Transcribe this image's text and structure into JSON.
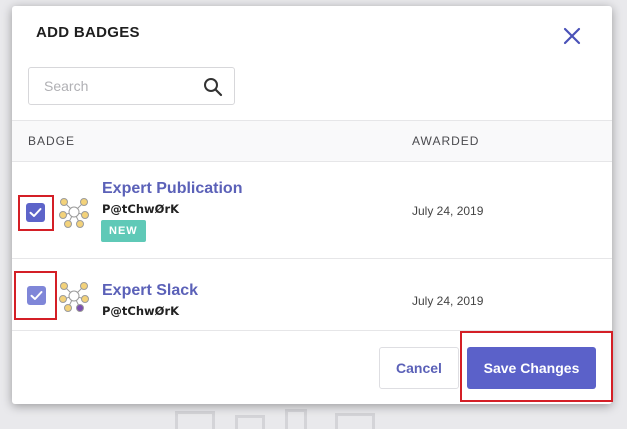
{
  "modal": {
    "title": "ADD BADGES",
    "close_icon": "close-icon"
  },
  "search": {
    "placeholder": "Search",
    "value": "",
    "icon": "search-icon"
  },
  "table": {
    "columns": [
      "BADGE",
      "AWARDED"
    ],
    "rows": [
      {
        "checked": true,
        "icon": "badge-network-icon",
        "name": "Expert Publication",
        "issuer": "P@tChwØrK",
        "tag": "NEW",
        "awarded": "July 24, 2019"
      },
      {
        "checked": true,
        "icon": "badge-network-icon",
        "name": "Expert Slack",
        "issuer": "P@tChwØrK",
        "tag": "",
        "awarded": "July 24, 2019"
      }
    ]
  },
  "footer": {
    "cancel_label": "Cancel",
    "save_label": "Save Changes"
  },
  "colors": {
    "accent": "#5b61c9",
    "new_tag": "#5fc9b7",
    "highlight": "#d41f26"
  }
}
